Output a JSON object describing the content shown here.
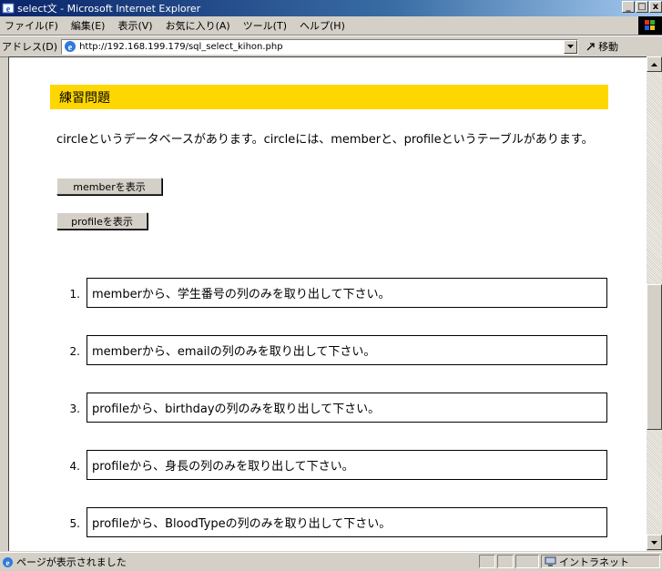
{
  "window": {
    "title": "select文 - Microsoft Internet Explorer",
    "icons": {
      "app": "ie-icon",
      "minimize": "_",
      "maximize": "□",
      "close": "x"
    }
  },
  "menu": {
    "items": [
      "ファイル(F)",
      "編集(E)",
      "表示(V)",
      "お気に入り(A)",
      "ツール(T)",
      "ヘルプ(H)"
    ]
  },
  "address": {
    "label": "アドレス(D)",
    "url": "http://192.168.199.179/sql_select_kihon.php",
    "go_label": "移動"
  },
  "page": {
    "heading": "練習問題",
    "heading_color": "#ffd700",
    "intro": "circleというデータベースがあります。circleには、memberと、profileというテーブルがあります。",
    "buttons": {
      "show_member": "memberを表示",
      "show_profile": "profileを表示"
    },
    "questions": [
      {
        "num": "1.",
        "text": "memberから、学生番号の列のみを取り出して下さい。"
      },
      {
        "num": "2.",
        "text": "memberから、emailの列のみを取り出して下さい。"
      },
      {
        "num": "3.",
        "text": "profileから、birthdayの列のみを取り出して下さい。"
      },
      {
        "num": "4.",
        "text": "profileから、身長の列のみを取り出して下さい。"
      },
      {
        "num": "5.",
        "text": "profileから、BloodTypeの列のみを取り出して下さい。"
      }
    ]
  },
  "status": {
    "text": "ページが表示されました",
    "zone": "イントラネット"
  }
}
